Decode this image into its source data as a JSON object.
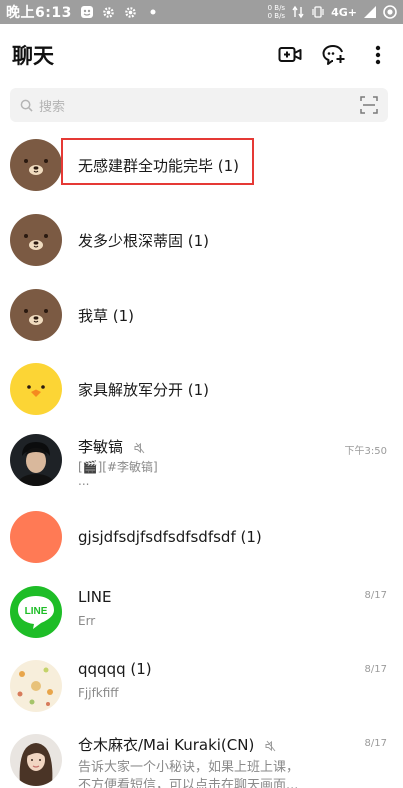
{
  "status_bar": {
    "time": "晚上6:13",
    "speed_top": "0 B/s",
    "speed_bottom": "0 B/s",
    "network": "4G+"
  },
  "header": {
    "title": "聊天",
    "actions": [
      "video-call-add-icon",
      "chat-add-icon",
      "more-vertical-icon"
    ]
  },
  "search": {
    "placeholder": "搜索"
  },
  "chats": [
    {
      "name": "无感建群全功能完毕 (1)",
      "avatar": "brown-bear",
      "highlighted": true
    },
    {
      "name": "发多少根深蒂固 (1)",
      "avatar": "brown-bear"
    },
    {
      "name": "我草 (1)",
      "avatar": "brown-bear"
    },
    {
      "name": "家具解放军分开 (1)",
      "avatar": "yellow-chick"
    },
    {
      "name": "李敏镐",
      "avatar": "photo-man",
      "muted": true,
      "time": "下午3:50",
      "preview_line1": "[🎬][#李敏镐]",
      "preview_line2": "..."
    },
    {
      "name": "gjsjdfsdjfsdfsdfsdfsdf (1)",
      "avatar": "orange-circle"
    },
    {
      "name": "LINE",
      "avatar": "line-logo",
      "time": "8/17",
      "preview_line1": "Err"
    },
    {
      "name": "qqqqq (1)",
      "avatar": "cartoon-pattern",
      "time": "8/17",
      "preview_line1": "Fjjfkfiff"
    },
    {
      "name": "仓木麻衣/Mai Kuraki(CN)",
      "avatar": "photo-woman",
      "muted": true,
      "time": "8/17",
      "preview_line1": "告诉大家一个小秘诀，如果上班上课，",
      "preview_line2": "不方便看短信，可以点击在聊天画面..."
    }
  ],
  "colors": {
    "status_bar": "#9e9e9e",
    "search_bg": "#f2f2f2",
    "bear_brown": "#7b5a43",
    "chick_yellow": "#fcd535",
    "orange": "#ff7a55",
    "line_green": "#1ebd27",
    "highlight_red": "#e53935"
  }
}
